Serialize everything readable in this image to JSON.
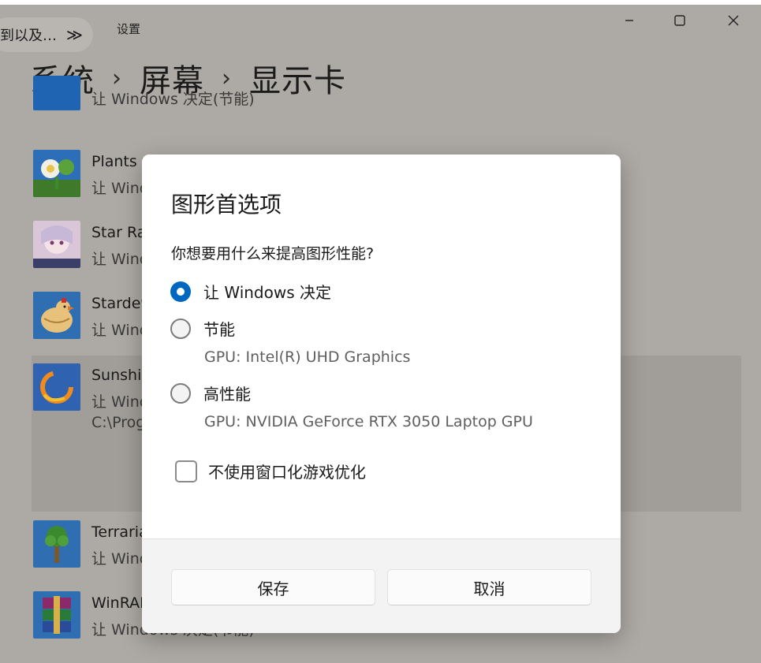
{
  "window": {
    "title": "设置",
    "tooltip_text": "到以及…",
    "tooltip_chevron": "≫",
    "breadcrumb": [
      "系统",
      "屏幕",
      "显示卡"
    ],
    "breadcrumb_sep": "›"
  },
  "apps": [
    {
      "name": "",
      "sub": "让 Windows 决定(节能)"
    },
    {
      "name": "Plants vs. Zombies",
      "sub": "让 Windows 决定"
    },
    {
      "name": "Star Rail",
      "sub": "让 Windows 决定"
    },
    {
      "name": "Stardew Valley",
      "sub": "让 Windows 决定"
    },
    {
      "name": "Sunshine",
      "sub": "让 Windows 决定",
      "path": "C:\\Program Files"
    },
    {
      "name": "Terraria",
      "sub": "让 Windows 决定"
    },
    {
      "name": "WinRAR",
      "sub": "让 Windows 决定(节能)"
    }
  ],
  "dialog": {
    "title": "图形首选项",
    "question": "你想要用什么来提高图形性能?",
    "options": [
      {
        "label": "让 Windows 决定",
        "desc": "",
        "selected": true
      },
      {
        "label": "节能",
        "desc": "GPU: Intel(R) UHD Graphics",
        "selected": false
      },
      {
        "label": "高性能",
        "desc": "GPU: NVIDIA GeForce RTX 3050 Laptop GPU",
        "selected": false
      }
    ],
    "checkbox_label": "不使用窗口化游戏优化",
    "checkbox_checked": false,
    "save_label": "保存",
    "cancel_label": "取消"
  },
  "colors": {
    "accent": "#0067c0",
    "overlay_bg": "#ada9a4",
    "dialog_bg": "#ffffff",
    "footer_bg": "#f3f3f3"
  }
}
